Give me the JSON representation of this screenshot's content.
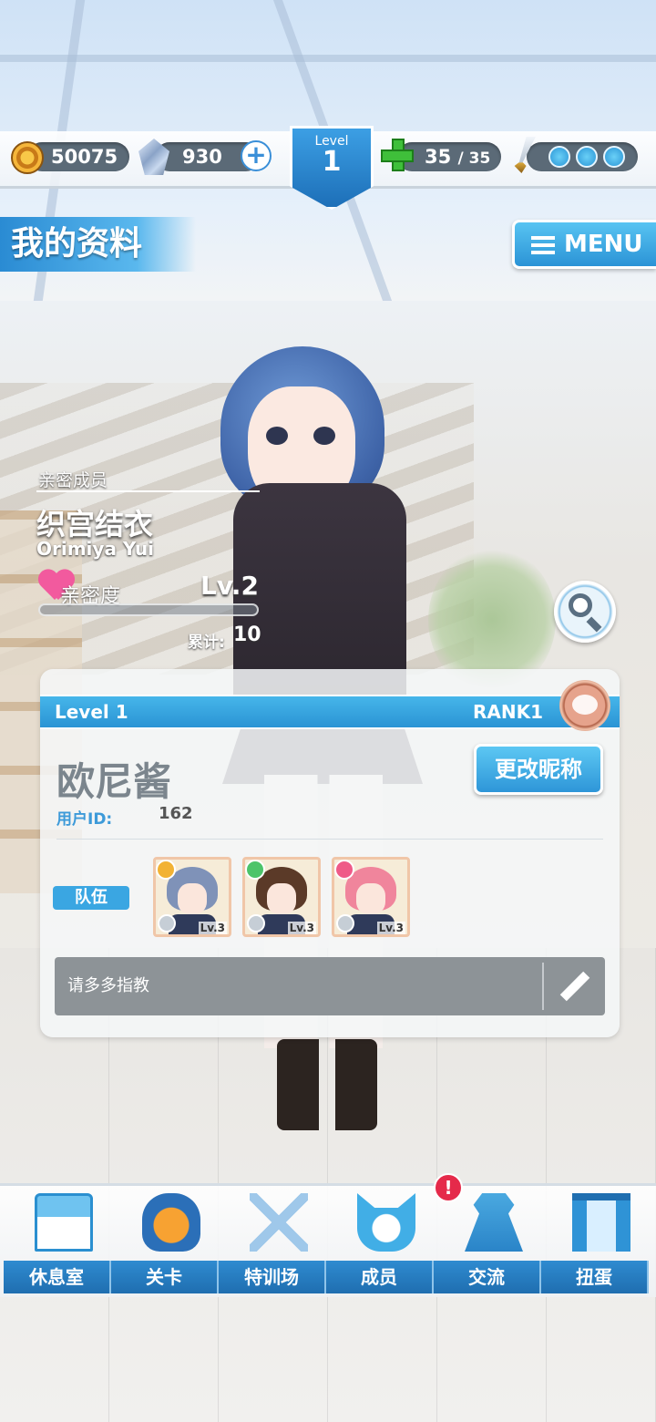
{
  "topbar": {
    "coins": "50075",
    "gems": "930",
    "add_symbol": "+",
    "level_label": "Level",
    "level": "1",
    "stamina_current": "35",
    "stamina_max": "/ 35",
    "charges_total": 3
  },
  "header": {
    "title": "我的资料",
    "menu_label": "MENU"
  },
  "intimacy": {
    "caption": "亲密成员",
    "name": "织宫结衣",
    "romaji": "Orimiya Yui",
    "label": "亲密度",
    "level": "Lv.2",
    "progress": 0.0,
    "total_label": "累计:",
    "total_value": "10"
  },
  "profile": {
    "level": "Level 1",
    "rank": "RANK1",
    "nickname": "欧尼酱",
    "uid_label": "用户ID:",
    "uid": "162",
    "rename_label": "更改昵称",
    "team_label": "队伍",
    "team": [
      {
        "level": "Lv.3",
        "type_color": "#f2b233",
        "hair_color": "#7f92b8"
      },
      {
        "level": "Lv.3",
        "type_color": "#4cc46a",
        "hair_color": "#5b3a28"
      },
      {
        "level": "Lv.3",
        "type_color": "#ef5a88",
        "hair_color": "#f0859c"
      }
    ],
    "comment": "请多多指教"
  },
  "nav": {
    "items": [
      {
        "label": "休息室",
        "icon": "school-icon"
      },
      {
        "label": "关卡",
        "icon": "monster-icon"
      },
      {
        "label": "特训场",
        "icon": "crossed-swords-icon"
      },
      {
        "label": "成员",
        "icon": "cat-mascot-icon"
      },
      {
        "label": "交流",
        "icon": "dress-icon"
      },
      {
        "label": "扭蛋",
        "icon": "curtain-icon"
      }
    ],
    "alert": "!"
  },
  "colors": {
    "accent_blue": "#2a94d4",
    "alert_red": "#e52a4a",
    "heart_pink": "#f25a9e"
  }
}
